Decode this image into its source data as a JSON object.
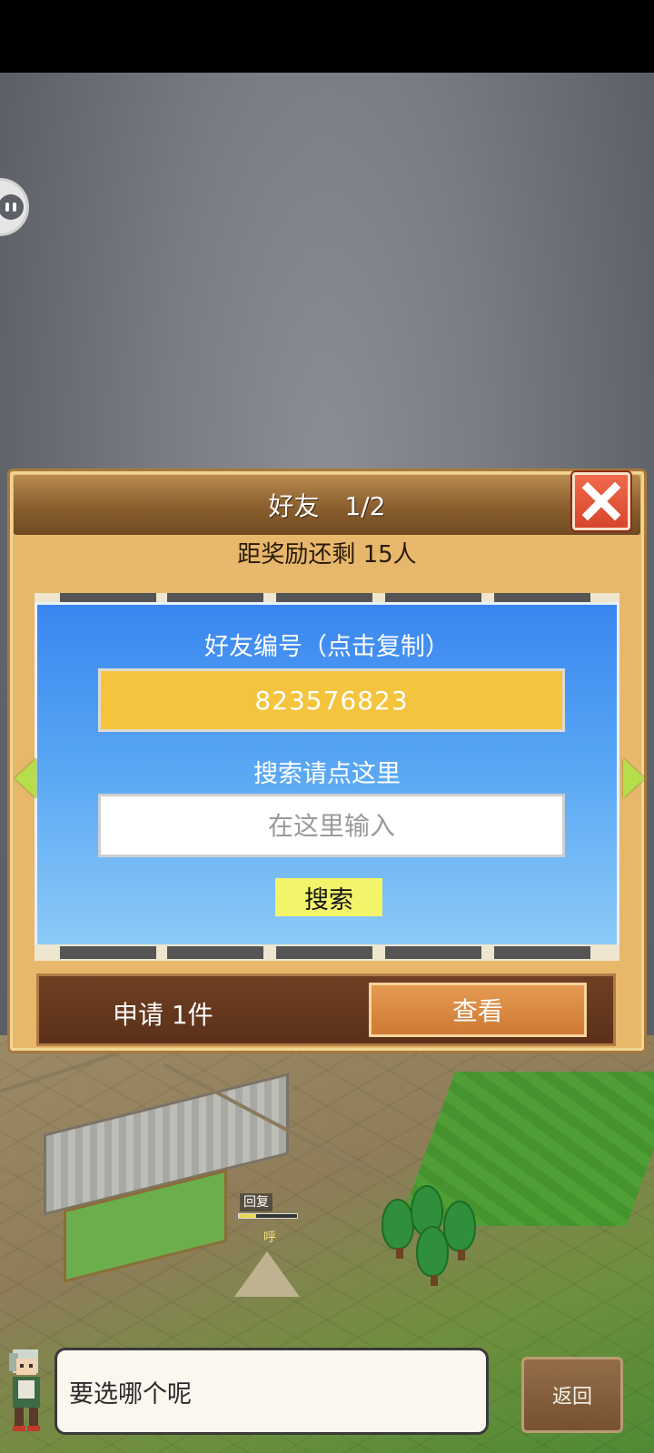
{
  "dialog": {
    "title": "好友　1/2",
    "reward_text": "距奖励还剩 15人",
    "friend_id_label": "好友编号（点击复制）",
    "friend_id": "823576823",
    "search_label": "搜索请点这里",
    "search_placeholder": "在这里输入",
    "search_button": "搜索",
    "request_label": "申请 1件",
    "view_button": "查看"
  },
  "scene": {
    "hint_label": "回复",
    "hint_progress": 0.3,
    "sigh_text": "呼"
  },
  "footer": {
    "speech": "要选哪个呢",
    "back_button": "返回"
  },
  "colors": {
    "panel_blue": "#3a86f0",
    "id_box_yellow": "#f5c43e",
    "search_button_yellow": "#f4f46a",
    "close_red": "#e2553a",
    "view_button_orange": "#d98840"
  },
  "icons": [
    "close-icon",
    "left-arrow-icon",
    "right-arrow-icon",
    "floating-assistant-icon",
    "character-avatar"
  ]
}
